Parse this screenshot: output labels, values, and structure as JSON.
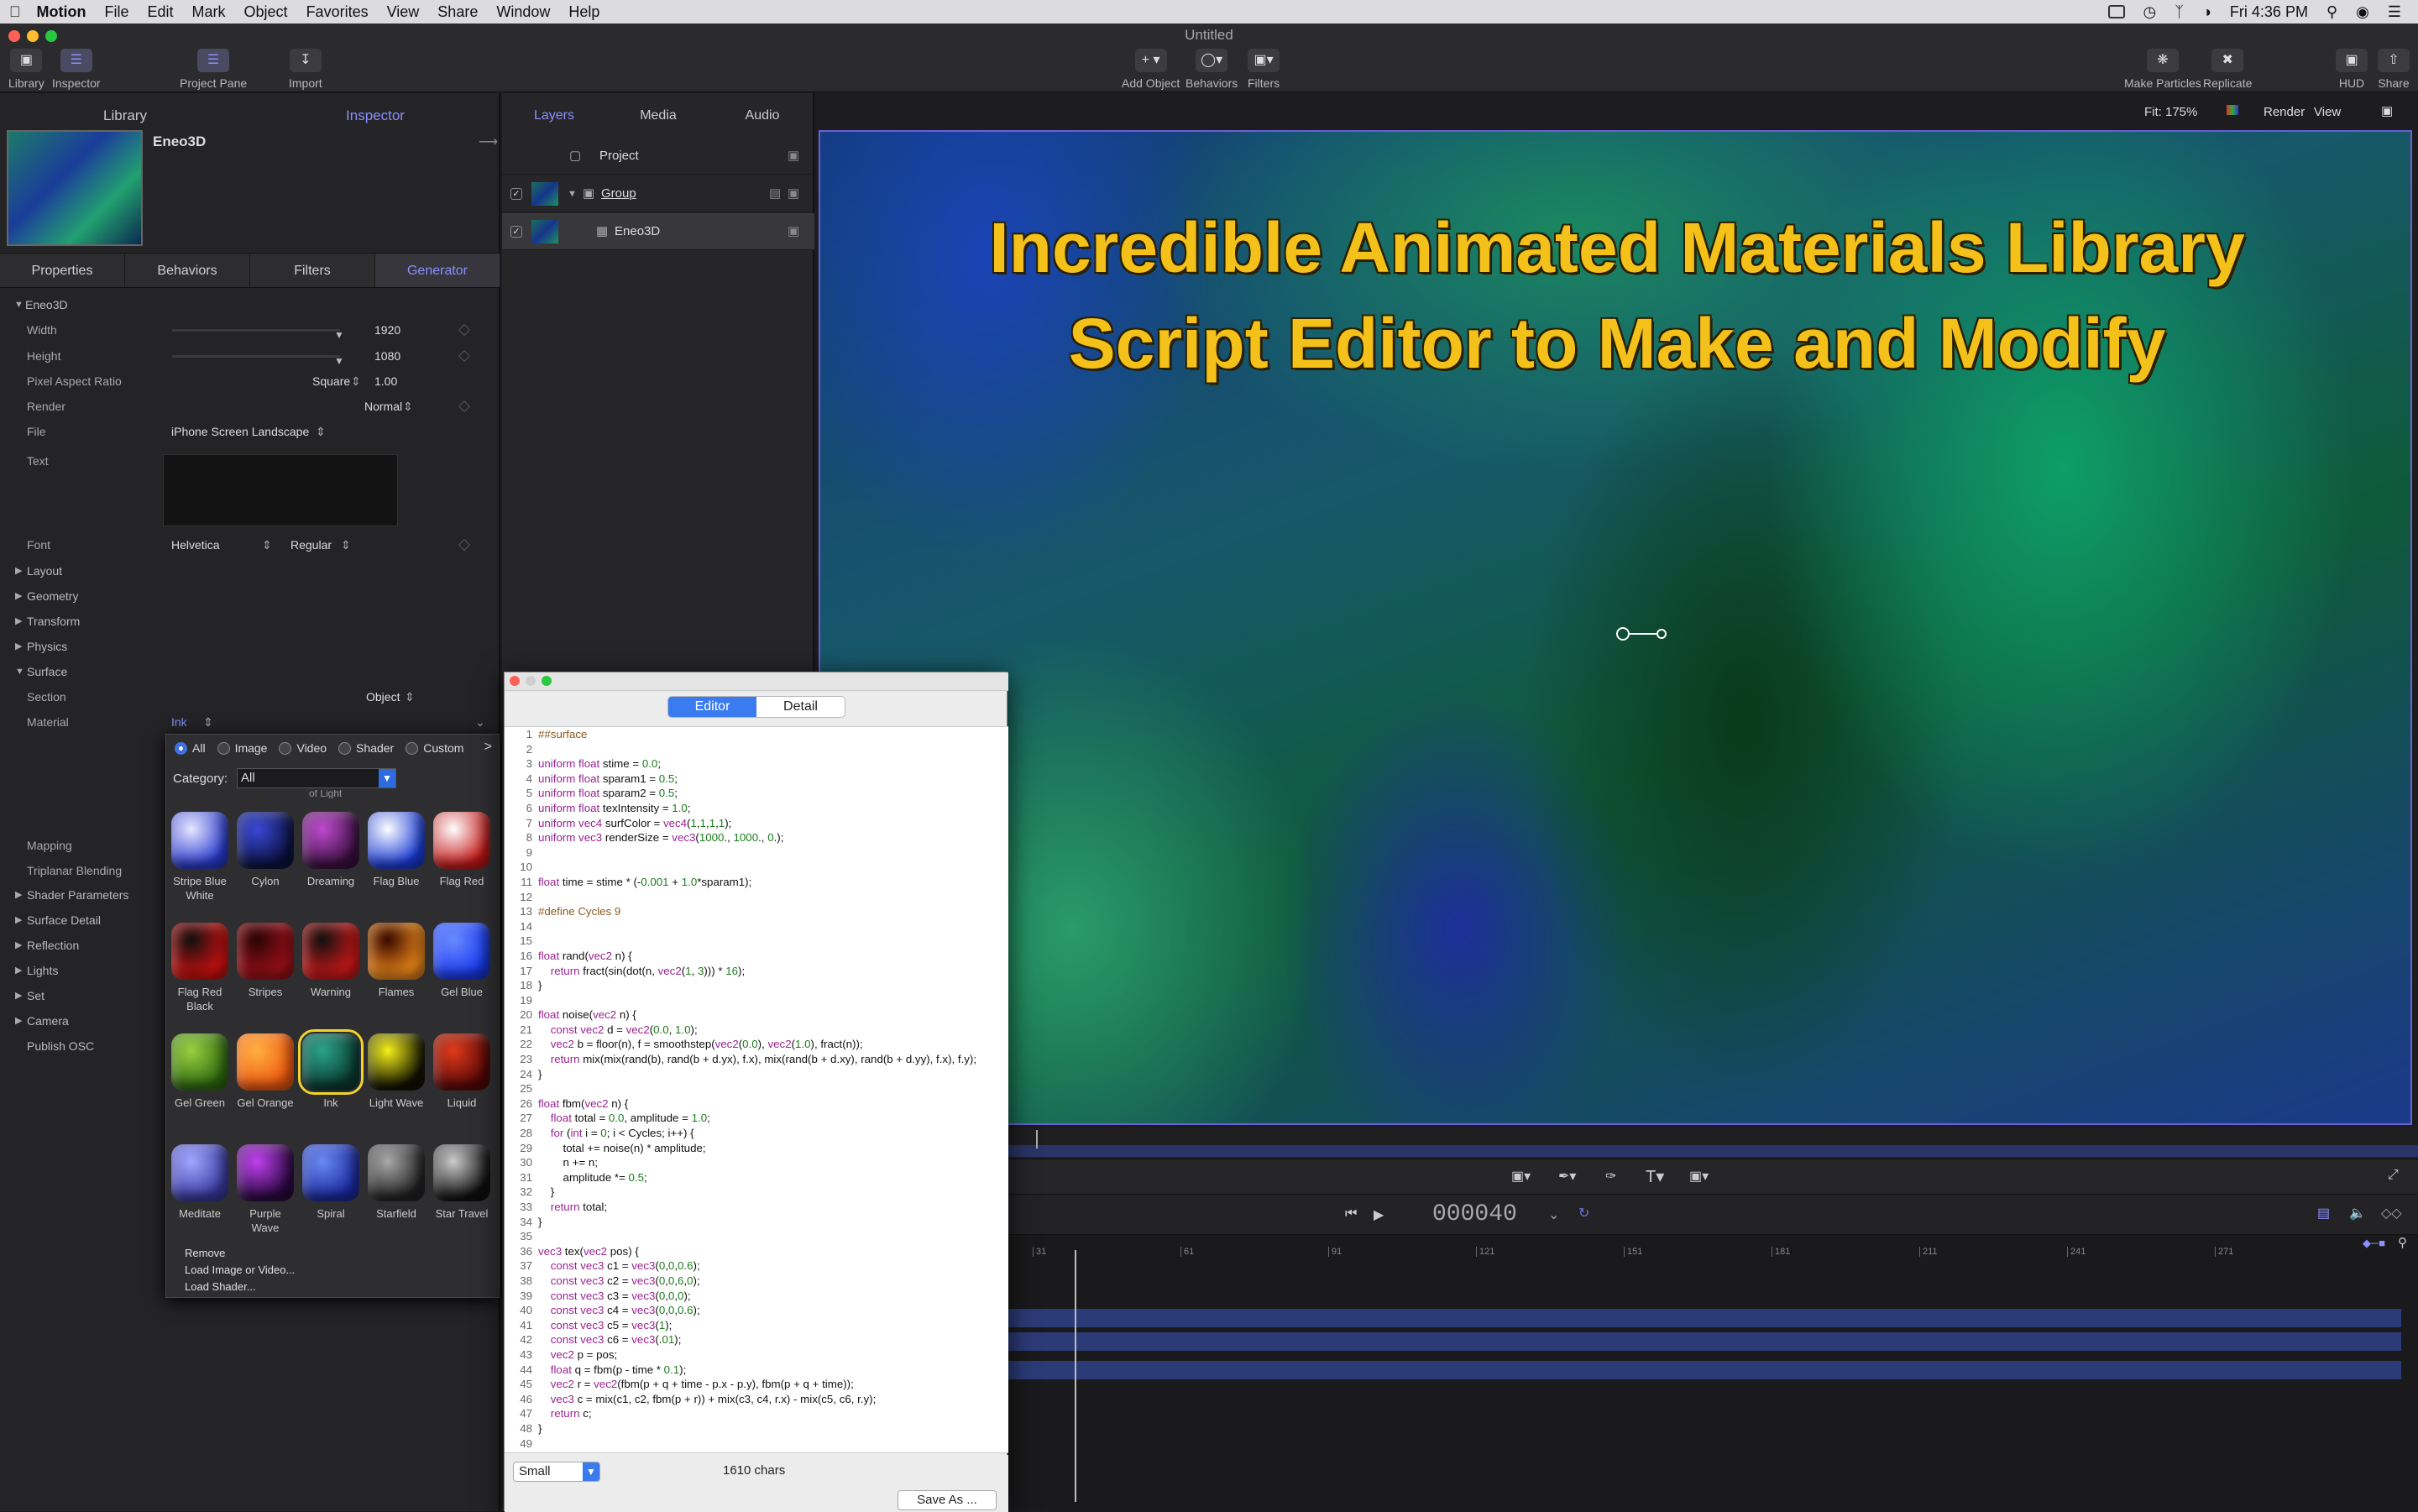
{
  "menubar": {
    "app": "Motion",
    "items": [
      "File",
      "Edit",
      "Mark",
      "Object",
      "Favorites",
      "View",
      "Share",
      "Window",
      "Help"
    ],
    "clock": "Fri 4:36 PM"
  },
  "window": {
    "title": "Untitled"
  },
  "toolbar": {
    "library": "Library",
    "inspector": "Inspector",
    "project_pane": "Project Pane",
    "import": "Import",
    "add_object": "Add Object",
    "behaviors": "Behaviors",
    "filters": "Filters",
    "make_particles": "Make Particles",
    "replicate": "Replicate",
    "hud": "HUD",
    "share": "Share"
  },
  "left_tabs": {
    "library": "Library",
    "inspector": "Inspector"
  },
  "inspector": {
    "object_name": "Eneo3D",
    "tabs": [
      "Properties",
      "Behaviors",
      "Filters",
      "Generator"
    ],
    "group": "Eneo3D",
    "width_label": "Width",
    "width_value": "1920",
    "height_label": "Height",
    "height_value": "1080",
    "par_label": "Pixel Aspect Ratio",
    "par_mode": "Square",
    "par_value": "1.00",
    "render_label": "Render",
    "render_value": "Normal",
    "file_label": "File",
    "file_value": "iPhone Screen Landscape",
    "text_label": "Text",
    "font_label": "Font",
    "font_family": "Helvetica",
    "font_style": "Regular",
    "sections_a": [
      "Layout",
      "Geometry",
      "Transform",
      "Physics"
    ],
    "surface": "Surface",
    "section_label": "Section",
    "section_value": "Object",
    "material_label": "Material",
    "material_value": "Ink",
    "mapping_label": "Mapping",
    "triplanar_label": "Triplanar Blending",
    "shader_params": "Shader Parameters",
    "sections_b": [
      "Surface Detail",
      "Reflection",
      "Lights",
      "Set",
      "Camera"
    ],
    "publish": "Publish OSC"
  },
  "picker": {
    "radios": [
      "All",
      "Image",
      "Video",
      "Shader",
      "Custom"
    ],
    "next": ">",
    "category_label": "Category:",
    "category_value": "All",
    "partial_label": "of Light",
    "materials": [
      {
        "name": "Stripe Blue White",
        "c1": "#2a3bd0",
        "c2": "#e8e8ff"
      },
      {
        "name": "Cylon",
        "c1": "#0b1240",
        "c2": "#3a48d8"
      },
      {
        "name": "Dreaming",
        "c1": "#3a1040",
        "c2": "#c04bd0"
      },
      {
        "name": "Flag Blue",
        "c1": "#1a3cd8",
        "c2": "#ffffff"
      },
      {
        "name": "Flag Red",
        "c1": "#c81a1a",
        "c2": "#ffffff"
      },
      {
        "name": "Flag Red Black",
        "c1": "#d01010",
        "c2": "#111111"
      },
      {
        "name": "Stripes",
        "c1": "#a0101a",
        "c2": "#2a0505"
      },
      {
        "name": "Warning",
        "c1": "#d01818",
        "c2": "#111111"
      },
      {
        "name": "Flames",
        "c1": "#f08a1a",
        "c2": "#3a0a00"
      },
      {
        "name": "Gel Blue",
        "c1": "#1a3cf0",
        "c2": "#6a8aff"
      },
      {
        "name": "Gel Green",
        "c1": "#2f6a10",
        "c2": "#9ad040"
      },
      {
        "name": "Gel Orange",
        "c1": "#f05a10",
        "c2": "#ffb040"
      },
      {
        "name": "Ink",
        "c1": "#0a3a30",
        "c2": "#2aa48a"
      },
      {
        "name": "Light Wave",
        "c1": "#111100",
        "c2": "#f4f01a"
      },
      {
        "name": "Liquid",
        "c1": "#5a0808",
        "c2": "#e03a1a"
      },
      {
        "name": "Meditate",
        "c1": "#3a3aa0",
        "c2": "#a0a8ff"
      },
      {
        "name": "Purple Wave",
        "c1": "#2a0840",
        "c2": "#c040f0"
      },
      {
        "name": "Spiral",
        "c1": "#1a2aa0",
        "c2": "#6a8af0"
      },
      {
        "name": "Starfield",
        "c1": "#222222",
        "c2": "#aaaaaa"
      },
      {
        "name": "Star Travel",
        "c1": "#111111",
        "c2": "#cccccc"
      }
    ],
    "actions": [
      "Remove",
      "Load Image or Video...",
      "Load Shader..."
    ]
  },
  "layers": {
    "tabs": [
      "Layers",
      "Media",
      "Audio"
    ],
    "project": "Project",
    "group": "Group",
    "item": "Eneo3D"
  },
  "canvas": {
    "fit": "Fit: 175%",
    "render": "Render",
    "view": "View",
    "headline1": "Incredible Animated Materials Library",
    "headline2": "Script Editor to Make and Modify"
  },
  "transport": {
    "timecode": "000040"
  },
  "timeline": {
    "ticks": [
      "31",
      "61",
      "91",
      "121",
      "151",
      "181",
      "211",
      "241",
      "271"
    ]
  },
  "editor": {
    "tabs": [
      "Editor",
      "Detail"
    ],
    "size": "Small",
    "chars": "1610 chars",
    "save": "Save As ...",
    "lines": [
      "##surface",
      "",
      "uniform float stime = 0.0;",
      "uniform float sparam1 = 0.5;",
      "uniform float sparam2 = 0.5;",
      "uniform float texIntensity = 1.0;",
      "uniform vec4 surfColor = vec4(1,1,1,1);",
      "uniform vec3 renderSize = vec3(1000., 1000., 0.);",
      "",
      "",
      "float time = stime * (-0.001 + 1.0*sparam1);",
      "",
      "#define Cycles 9",
      "",
      "",
      "float rand(vec2 n) {",
      "    return fract(sin(dot(n, vec2(1, 3))) * 16);",
      "}",
      "",
      "float noise(vec2 n) {",
      "    const vec2 d = vec2(0.0, 1.0);",
      "    vec2 b = floor(n), f = smoothstep(vec2(0.0), vec2(1.0), fract(n));",
      "    return mix(mix(rand(b), rand(b + d.yx), f.x), mix(rand(b + d.xy), rand(b + d.yy), f.x), f.y);",
      "}",
      "",
      "float fbm(vec2 n) {",
      "    float total = 0.0, amplitude = 1.0;",
      "    for (int i = 0; i < Cycles; i++) {",
      "        total += noise(n) * amplitude;",
      "        n += n;",
      "        amplitude *= 0.5;",
      "    }",
      "    return total;",
      "}",
      "",
      "vec3 tex(vec2 pos) {",
      "    const vec3 c1 = vec3(0,0,0.6);",
      "    const vec3 c2 = vec3(0,0,6,0);",
      "    const vec3 c3 = vec3(0,0,0);",
      "    const vec3 c4 = vec3(0,0,0.6);",
      "    const vec3 c5 = vec3(1);",
      "    const vec3 c6 = vec3(.01);",
      "    vec2 p = pos;",
      "    float q = fbm(p - time * 0.1);",
      "    vec2 r = vec2(fbm(p + q + time - p.x - p.y), fbm(p + q + time));",
      "    vec3 c = mix(c1, c2, fbm(p + r)) + mix(c3, c4, r.x) - mix(c5, c6, r.y);",
      "    return c;",
      "}",
      ""
    ]
  }
}
